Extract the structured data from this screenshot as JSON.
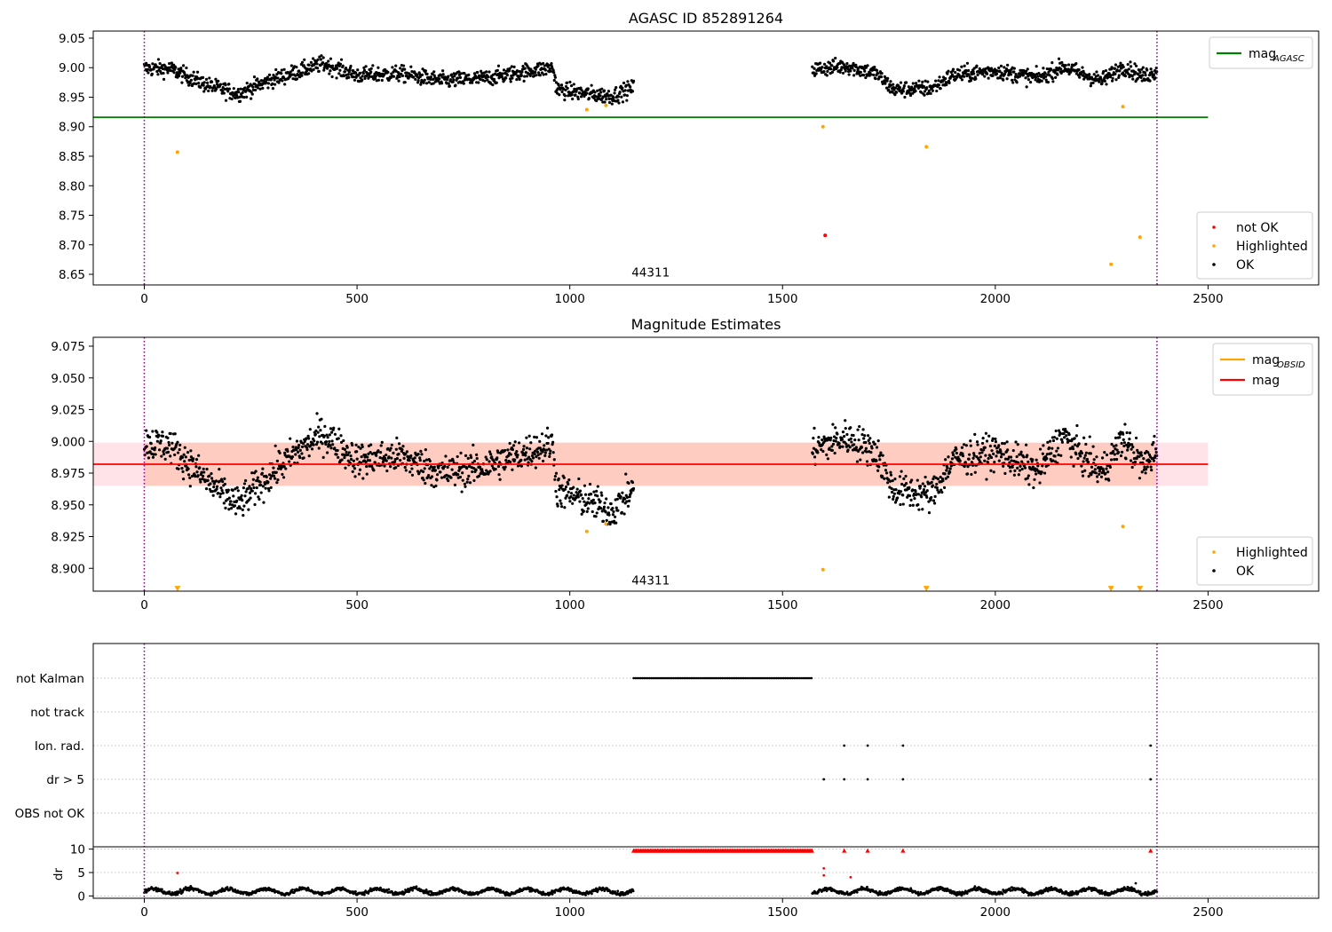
{
  "chart_data": [
    {
      "type": "scatter",
      "title": "AGASC ID 852891264",
      "xlim": [
        -120,
        2760
      ],
      "ylim": [
        8.632,
        9.062
      ],
      "xticks": [
        0,
        500,
        1000,
        1500,
        2000,
        2500
      ],
      "yticks": [
        8.65,
        8.7,
        8.75,
        8.8,
        8.85,
        8.9,
        8.95,
        9.0,
        9.05
      ],
      "ytick_labels": [
        "8.65",
        "8.70",
        "8.75",
        "8.80",
        "8.85",
        "8.90",
        "8.95",
        "9.00",
        "9.05"
      ],
      "annotation": {
        "text": "44311",
        "x": 1190,
        "y": 8.648
      },
      "vlines": {
        "x": [
          0,
          2380
        ],
        "color": "#800080"
      },
      "hline": {
        "name": "mag_AGASC",
        "y": 8.916,
        "x_range": [
          -120,
          2500
        ],
        "color": "#008000"
      },
      "legend_top": [
        {
          "label": "mag",
          "sub": "AGASC",
          "color": "#008000"
        }
      ],
      "legend_bottom": [
        {
          "label": "not OK",
          "color": "#ff0000"
        },
        {
          "label": "Highlighted",
          "color": "#ffa500"
        },
        {
          "label": "OK",
          "color": "#000000"
        }
      ],
      "series": [
        {
          "name": "not OK",
          "color": "#ff0000",
          "points": [
            [
              1600,
              8.716
            ]
          ]
        },
        {
          "name": "Highlighted",
          "color": "#ffa500",
          "points": [
            [
              78,
              8.857
            ],
            [
              1040,
              8.929
            ],
            [
              1085,
              8.936
            ],
            [
              1595,
              8.9
            ],
            [
              1838,
              8.866
            ],
            [
              2272,
              8.667
            ],
            [
              2300,
              8.934
            ],
            [
              2340,
              8.713
            ]
          ]
        },
        {
          "name": "OK",
          "color": "#000000",
          "trend": [
            [
              0,
              8.999
            ],
            [
              60,
              8.998
            ],
            [
              150,
              8.97
            ],
            [
              220,
              8.956
            ],
            [
              300,
              8.98
            ],
            [
              360,
              8.993
            ],
            [
              420,
              9.007
            ],
            [
              500,
              8.987
            ],
            [
              600,
              8.99
            ],
            [
              700,
              8.978
            ],
            [
              800,
              8.982
            ],
            [
              900,
              8.994
            ],
            [
              960,
              9.0
            ],
            [
              970,
              8.963
            ],
            [
              1050,
              8.955
            ],
            [
              1100,
              8.952
            ],
            [
              1150,
              8.966
            ],
            null,
            [
              1570,
              8.997
            ],
            [
              1650,
              9.003
            ],
            [
              1720,
              8.99
            ],
            [
              1760,
              8.963
            ],
            [
              1850,
              8.965
            ],
            [
              1900,
              8.987
            ],
            [
              2000,
              8.995
            ],
            [
              2100,
              8.982
            ],
            [
              2160,
              9.002
            ],
            [
              2200,
              8.99
            ],
            [
              2250,
              8.978
            ],
            [
              2300,
              9.002
            ],
            [
              2350,
              8.985
            ],
            [
              2380,
              8.995
            ]
          ]
        }
      ]
    },
    {
      "type": "scatter",
      "title": "Magnitude Estimates",
      "xlim": [
        -120,
        2760
      ],
      "ylim": [
        8.882,
        9.082
      ],
      "xticks": [
        0,
        500,
        1000,
        1500,
        2000,
        2500
      ],
      "yticks": [
        8.9,
        8.925,
        8.95,
        8.975,
        9.0,
        9.025,
        9.05,
        9.075
      ],
      "ytick_labels": [
        "8.900",
        "8.925",
        "8.950",
        "8.975",
        "9.000",
        "9.025",
        "9.050",
        "9.075"
      ],
      "annotation": {
        "text": "44311",
        "x": 1190,
        "y": 8.888
      },
      "vlines": {
        "x": [
          0,
          2380
        ],
        "color": "#800080"
      },
      "band": {
        "y_range": [
          8.965,
          8.999
        ],
        "x_range": [
          -120,
          2500
        ]
      },
      "hline": {
        "name": "mag",
        "y": 8.982,
        "x_range": [
          -120,
          2500
        ],
        "color": "#ff0000"
      },
      "legend_top": [
        {
          "label": "mag",
          "sub": "OBSID",
          "color": "#ffa500"
        },
        {
          "label": "mag",
          "sub": "",
          "color": "#ff0000"
        }
      ],
      "legend_bottom": [
        {
          "label": "Highlighted",
          "color": "#ffa500"
        },
        {
          "label": "OK",
          "color": "#000000"
        }
      ],
      "series": [
        {
          "name": "Highlighted",
          "color": "#ffa500",
          "points": [
            [
              1040,
              8.929
            ],
            [
              1085,
              8.935
            ],
            [
              1595,
              8.899
            ],
            [
              2300,
              8.933
            ]
          ]
        },
        {
          "name": "Highlighted (off-scale)",
          "color": "#ffa500",
          "marker": "triangle-down",
          "points": [
            [
              78,
              8.884
            ],
            [
              1838,
              8.884
            ],
            [
              2272,
              8.884
            ],
            [
              2340,
              8.884
            ]
          ]
        },
        {
          "name": "OK",
          "color": "#000000",
          "trend": [
            [
              0,
              8.999
            ],
            [
              60,
              8.997
            ],
            [
              150,
              8.968
            ],
            [
              220,
              8.95
            ],
            [
              300,
              8.975
            ],
            [
              360,
              8.992
            ],
            [
              420,
              9.006
            ],
            [
              500,
              8.985
            ],
            [
              600,
              8.988
            ],
            [
              700,
              8.975
            ],
            [
              800,
              8.98
            ],
            [
              900,
              8.992
            ],
            [
              960,
              8.998
            ],
            [
              970,
              8.962
            ],
            [
              1050,
              8.952
            ],
            [
              1100,
              8.945
            ],
            [
              1150,
              8.963
            ],
            null,
            [
              1570,
              8.994
            ],
            [
              1650,
              9.003
            ],
            [
              1720,
              8.992
            ],
            [
              1760,
              8.962
            ],
            [
              1850,
              8.958
            ],
            [
              1900,
              8.985
            ],
            [
              2000,
              8.992
            ],
            [
              2100,
              8.976
            ],
            [
              2160,
              9.005
            ],
            [
              2200,
              8.99
            ],
            [
              2250,
              8.975
            ],
            [
              2300,
              9.002
            ],
            [
              2350,
              8.98
            ],
            [
              2380,
              8.995
            ]
          ]
        }
      ]
    },
    {
      "type": "scatter",
      "title": "",
      "xlim": [
        -120,
        2760
      ],
      "xticks": [
        0,
        500,
        1000,
        1500,
        2000,
        2500
      ],
      "vlines": {
        "x": [
          0,
          2380
        ],
        "color": "#800080"
      },
      "flag_rows": [
        "not Kalman",
        "not track",
        "Ion. rad.",
        "dr > 5",
        "OBS not OK"
      ],
      "flags": [
        {
          "row": "not Kalman",
          "x_ranges": [
            [
              1150,
              1570
            ]
          ],
          "color": "#000000"
        },
        {
          "row": "Ion. rad.",
          "x": [
            1645,
            1700,
            1783,
            2365
          ],
          "color": "#000000"
        },
        {
          "row": "dr > 5",
          "x": [
            1597,
            1645,
            1700,
            1783,
            2365
          ],
          "color": "#000000"
        }
      ],
      "dr_panel": {
        "ylabel": "dr",
        "ylim": [
          -0.5,
          10.5
        ],
        "yticks": [
          0,
          5,
          10
        ],
        "ytick_labels": [
          "0",
          "5",
          "10"
        ],
        "ok_color": "#000000",
        "bad_color": "#ff0000",
        "bad_points": [
          [
            78,
            4.9
          ],
          [
            1597,
            5.9
          ],
          [
            1597,
            4.4
          ],
          [
            1660,
            4.0
          ],
          [
            1645,
            9.7
          ],
          [
            1700,
            9.7
          ],
          [
            1783,
            9.7
          ],
          [
            2365,
            9.7
          ]
        ],
        "capped_range": {
          "x_range": [
            1150,
            1570
          ],
          "y": 9.7
        },
        "ok_ranges": [
          [
            0,
            1150
          ],
          [
            1570,
            2380
          ]
        ]
      }
    }
  ]
}
